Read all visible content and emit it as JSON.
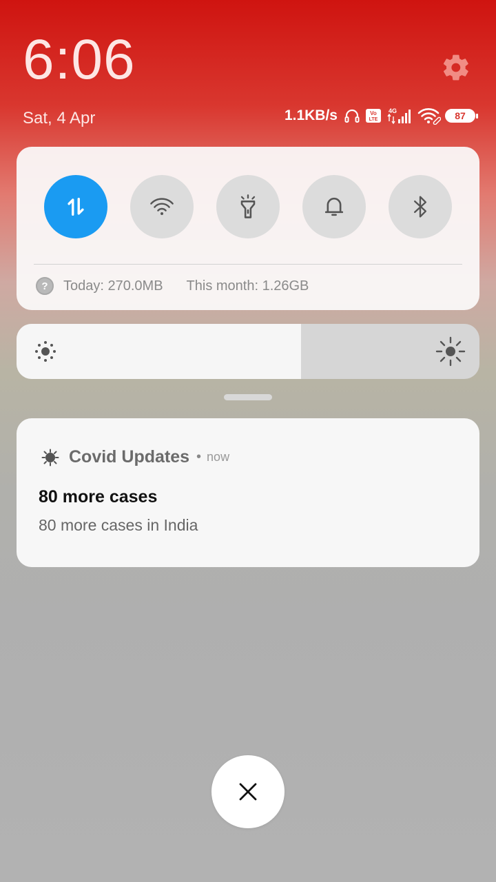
{
  "header": {
    "time": "6:06",
    "date": "Sat, 4 Apr",
    "settings_icon": "gear-icon"
  },
  "status_bar": {
    "speed": "1.1KB/s",
    "volte": "Vo LTE",
    "network": "4G",
    "battery": "87",
    "icons": [
      "headset-icon",
      "volte-icon",
      "signal-4g-icon",
      "wifi-icon",
      "battery-icon"
    ]
  },
  "quick_settings": {
    "toggles": [
      {
        "name": "mobile-data",
        "icon": "data-transfer-icon",
        "on": true
      },
      {
        "name": "wifi",
        "icon": "wifi-icon",
        "on": false
      },
      {
        "name": "flashlight",
        "icon": "flashlight-icon",
        "on": false
      },
      {
        "name": "sound",
        "icon": "bell-icon",
        "on": false
      },
      {
        "name": "bluetooth",
        "icon": "bluetooth-icon",
        "on": false
      }
    ],
    "usage": {
      "today": "Today: 270.0MB",
      "month": "This month: 1.26GB",
      "help_glyph": "?"
    }
  },
  "brightness": {
    "level_fraction": 0.615
  },
  "notification": {
    "app_name": "Covid Updates",
    "separator": "•",
    "time": "now",
    "title": "80 more cases",
    "body": "80 more cases in India",
    "app_icon": "virus-icon"
  },
  "colors": {
    "accent": "#1a9bf2",
    "header_red": "#cf1410"
  }
}
